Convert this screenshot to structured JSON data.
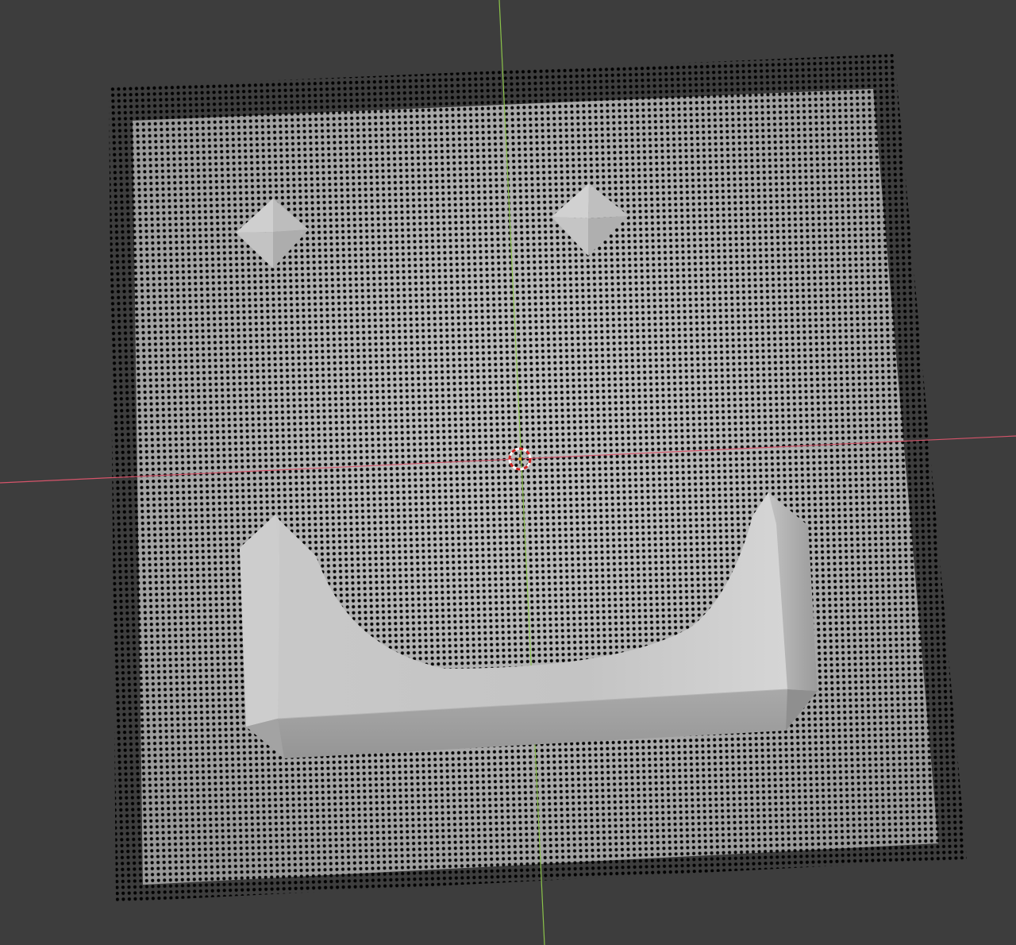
{
  "viewport": {
    "mode": "3d-viewport",
    "background_color": "#3d3d3d",
    "objects": [
      {
        "name": "plane-mesh",
        "kind": "subdivided-plane",
        "display": "vertices",
        "vertex_color": "#000000",
        "face_color": "#b8b8b8"
      },
      {
        "name": "left-eye",
        "kind": "octahedron",
        "color": "#c4c4c4"
      },
      {
        "name": "right-eye",
        "kind": "octahedron",
        "color": "#c4c4c4"
      },
      {
        "name": "mouth",
        "kind": "u-shaped-extrusion",
        "color": "#c8c8c8"
      }
    ],
    "axes": {
      "x_axis_color": "#d5546a",
      "y_axis_color": "#8bc34a"
    },
    "cursor": {
      "name": "3d-cursor",
      "ring_color_a": "#d02020",
      "ring_color_b": "#ffffff"
    },
    "icons": [
      "3d-cursor-icon"
    ]
  }
}
